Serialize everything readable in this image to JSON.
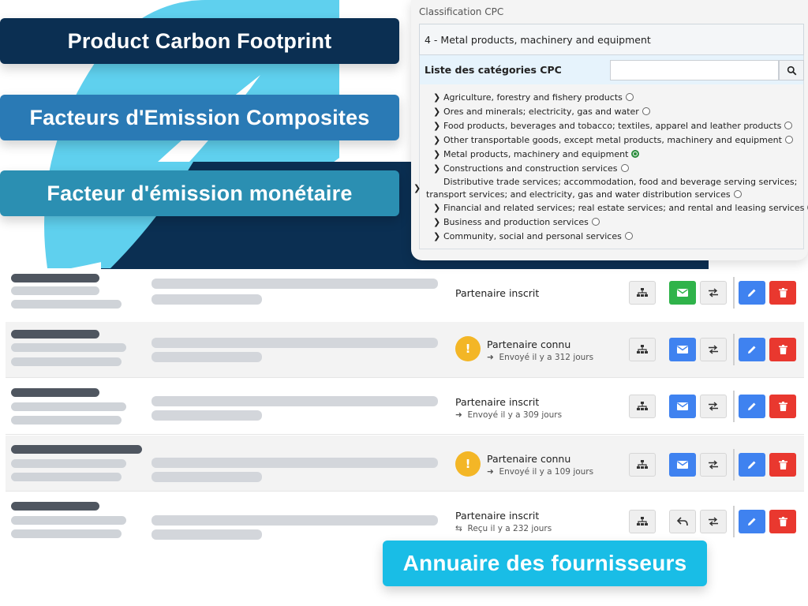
{
  "banners": {
    "product_carbon_footprint": "Product Carbon Footprint",
    "composite_factors": "Facteurs d'Emission Composites",
    "monetary_factor": "Facteur d'émission monétaire",
    "supplier_directory": "Annuaire des fournisseurs"
  },
  "cpc": {
    "title": "Classification CPC",
    "selected_value": "4 - Metal products, machinery and equipment",
    "list_label": "Liste des catégories CPC",
    "search_placeholder": "",
    "items": [
      {
        "label": "Agriculture, forestry and fishery products",
        "checked": false
      },
      {
        "label": "Ores and minerals; electricity, gas and water",
        "checked": false
      },
      {
        "label": "Food products, beverages and tobacco; textiles, apparel and leather products",
        "checked": false
      },
      {
        "label": "Other transportable goods, except metal products, machinery and equipment",
        "checked": false
      },
      {
        "label": "Metal products, machinery and equipment",
        "checked": true
      },
      {
        "label": "Constructions and construction services",
        "checked": false
      },
      {
        "label": "Distributive trade services; accommodation, food and beverage serving services; transport services; and electricity, gas and water distribution services",
        "checked": false
      },
      {
        "label": "Financial and related services; real estate services; and rental and leasing services",
        "checked": false
      },
      {
        "label": "Business and production services",
        "checked": false
      },
      {
        "label": "Community, social and personal services",
        "checked": false
      }
    ]
  },
  "suppliers": [
    {
      "status": "Partenaire inscrit",
      "sub": "",
      "warn": false,
      "mail": "green",
      "reply": false
    },
    {
      "status": "Partenaire connu",
      "sub": "Envoyé il y a 312 jours",
      "sub_icon": "arrow-right",
      "warn": true,
      "mail": "blue",
      "reply": false
    },
    {
      "status": "Partenaire inscrit",
      "sub": "Envoyé il y a 309 jours",
      "sub_icon": "arrow-right",
      "warn": false,
      "mail": "blue",
      "reply": false
    },
    {
      "status": "Partenaire connu",
      "sub": "Envoyé il y a 109 jours",
      "sub_icon": "arrow-right",
      "warn": true,
      "mail": "blue",
      "reply": false
    },
    {
      "status": "Partenaire inscrit",
      "sub": "Reçu il y a 232 jours",
      "sub_icon": "swap-arrows",
      "warn": false,
      "mail": "none",
      "reply": true
    }
  ],
  "colors": {
    "navy": "#0b2f52",
    "steel_blue": "#2a7ab5",
    "teal": "#2b8fb2",
    "cyan": "#19bde6",
    "green": "#2fb34a",
    "blue": "#3f82f0",
    "red": "#e9382f",
    "warning": "#f3b626"
  },
  "warning_glyph": "!"
}
